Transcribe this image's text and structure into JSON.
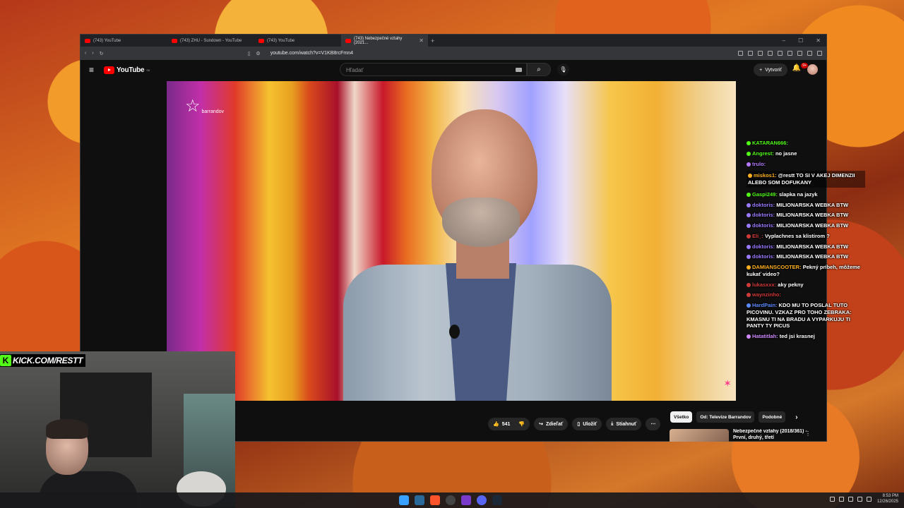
{
  "browser": {
    "tabs": [
      {
        "title": "(743) YouTube",
        "active": false
      },
      {
        "title": "(743) ZHU - Sundown - YouTube",
        "active": false
      },
      {
        "title": "(743) YouTube",
        "active": false
      },
      {
        "title": "(743) Nebezpečné vztahy (2021...",
        "active": true
      }
    ],
    "url": "youtube.com/watch?v=V1KB8rcFmn4"
  },
  "youtube": {
    "logo_text": "YouTube",
    "country_code": "SK",
    "search_placeholder": "Hľadať",
    "create_label": "Vytvoriť",
    "notifications_badge": "9+"
  },
  "video": {
    "channel_watermark": "barrandov"
  },
  "actions": {
    "like_count": "541",
    "share_label": "Zdieľať",
    "save_label": "Uložiť",
    "download_label": "Stiahnuť"
  },
  "recommendations": {
    "chips": [
      "Všetko",
      "Od: Televize Barrandov",
      "Podobné"
    ],
    "first_item_title": "Nebezpečné vztahy (2018/361) - První, druhý, třetí"
  },
  "chat": [
    {
      "user": "KATARAN666:",
      "text": "",
      "color": "#53fc18",
      "highlight": false
    },
    {
      "user": "Angrest:",
      "text": "no jasne",
      "color": "#53fc18",
      "highlight": false
    },
    {
      "user": "trulo:",
      "text": "",
      "color": "#b57aff",
      "highlight": false
    },
    {
      "user": "miskos1:",
      "text": "@restt TO SI V AKEJ DIMENZII ALEBO SOM DOFUKANY",
      "color": "#ffb020",
      "highlight": true
    },
    {
      "user": "Gaspi249:",
      "text": "slapka na jazyk",
      "color": "#53fc18",
      "highlight": false
    },
    {
      "user": "doktoris:",
      "text": "MILIONARSKA WEBKA BTW",
      "color": "#9a7aff",
      "highlight": false
    },
    {
      "user": "doktoris:",
      "text": "MILIONARSKA WEBKA BTW",
      "color": "#9a7aff",
      "highlight": false
    },
    {
      "user": "doktoris:",
      "text": "MILIONARSKA WEBKA BTW",
      "color": "#9a7aff",
      "highlight": false
    },
    {
      "user": "Eli_:",
      "text": "Vyplachnes sa klistirom ?",
      "color": "#d03a3a",
      "highlight": false
    },
    {
      "user": "doktoris:",
      "text": "MILIONARSKA WEBKA BTW",
      "color": "#9a7aff",
      "highlight": false
    },
    {
      "user": "doktoris:",
      "text": "MILIONARSKA WEBKA BTW",
      "color": "#9a7aff",
      "highlight": false
    },
    {
      "user": "DAMIANSCOOTER:",
      "text": "Pekný príbeh, môžeme kukať video?",
      "color": "#ffb020",
      "highlight": false
    },
    {
      "user": "lukasxxx:",
      "text": "aky pekny",
      "color": "#d03a3a",
      "highlight": false
    },
    {
      "user": "waynzinho:",
      "text": "",
      "color": "#d03a3a",
      "highlight": false
    },
    {
      "user": "HardPain:",
      "text": "KDO MU TO POSLAL TUTO PICOVINU. VZKAZ PRO TOHO ZEBRAKA: KMASNU TI NA BRADU A VYPARKUJU TI PANTY TY PICUS",
      "color": "#5a8aff",
      "highlight": false
    },
    {
      "user": "Hatatitlah:",
      "text": "ted jsi krasnej",
      "color": "#d08aff",
      "highlight": false
    }
  ],
  "stream": {
    "kick_url": "KICK.COM/RESTT"
  },
  "taskbar": {
    "time": "8:53 PM",
    "date": "12/26/2025"
  },
  "colors": {
    "yt_red": "#ff0000",
    "kick_green": "#53fc18"
  }
}
